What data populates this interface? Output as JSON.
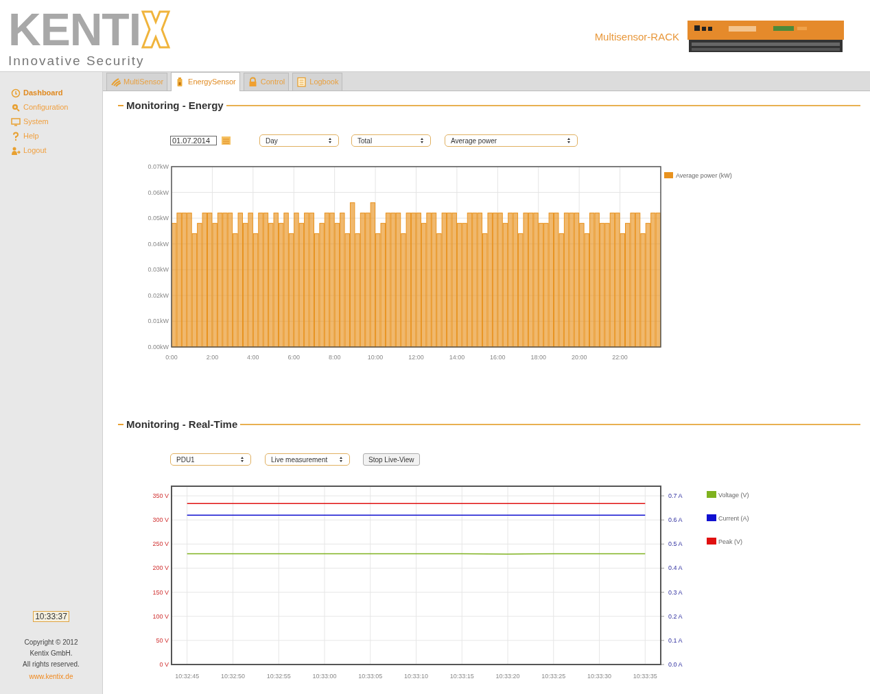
{
  "header": {
    "logo_text": "KENTI",
    "tagline": "Innovative Security",
    "device_name": "Multisensor-RACK"
  },
  "sidebar": {
    "items": [
      {
        "label": "Dashboard",
        "selected": true
      },
      {
        "label": "Configuration",
        "selected": false
      },
      {
        "label": "System",
        "selected": false
      },
      {
        "label": "Help",
        "selected": false
      },
      {
        "label": "Logout",
        "selected": false
      }
    ],
    "clock": "10:33:37",
    "copyright": [
      "Copyright © 2012",
      "Kentix GmbH.",
      "All rights reserved."
    ],
    "link": "www.kentix.de"
  },
  "tabs": [
    {
      "label": "MultiSensor",
      "selected": false
    },
    {
      "label": "EnergySensor",
      "selected": true
    },
    {
      "label": "Control",
      "selected": false
    },
    {
      "label": "Logbook",
      "selected": false
    }
  ],
  "energy": {
    "title": "Monitoring - Energy",
    "date": "01.07.2014",
    "selects": [
      "Day",
      "Total",
      "Average power"
    ],
    "chart_data": {
      "type": "bar",
      "x": [
        0,
        0.25,
        0.5,
        0.75,
        1,
        1.25,
        1.5,
        1.75,
        2,
        2.25,
        2.5,
        2.75,
        3,
        3.25,
        3.5,
        3.75,
        4,
        4.25,
        4.5,
        4.75,
        5,
        5.25,
        5.5,
        5.75,
        6,
        6.25,
        6.5,
        6.75,
        7,
        7.25,
        7.5,
        7.75,
        8,
        8.25,
        8.5,
        8.75,
        9,
        9.25,
        9.5,
        9.75,
        10,
        10.25,
        10.5,
        10.75,
        11,
        11.25,
        11.5,
        11.75,
        12,
        12.25,
        12.5,
        12.75,
        13,
        13.25,
        13.5,
        13.75,
        14,
        14.25,
        14.5,
        14.75,
        15,
        15.25,
        15.5,
        15.75,
        16,
        16.25,
        16.5,
        16.75,
        17,
        17.25,
        17.5,
        17.75,
        18,
        18.25,
        18.5,
        18.75,
        19,
        19.25,
        19.5,
        19.75,
        20,
        20.25,
        20.5,
        20.75,
        21,
        21.25,
        21.5,
        21.75,
        22,
        22.25,
        22.5,
        22.75,
        23,
        23.25,
        23.5,
        23.75
      ],
      "series": [
        {
          "name": "Average power (kW)",
          "color": "#e8921e",
          "values": [
            0.048,
            0.052,
            0.052,
            0.052,
            0.044,
            0.048,
            0.052,
            0.052,
            0.048,
            0.052,
            0.052,
            0.052,
            0.044,
            0.052,
            0.048,
            0.052,
            0.044,
            0.052,
            0.052,
            0.048,
            0.052,
            0.048,
            0.052,
            0.044,
            0.052,
            0.048,
            0.052,
            0.052,
            0.044,
            0.048,
            0.052,
            0.052,
            0.048,
            0.052,
            0.044,
            0.056,
            0.044,
            0.052,
            0.052,
            0.056,
            0.044,
            0.048,
            0.052,
            0.052,
            0.052,
            0.044,
            0.052,
            0.052,
            0.052,
            0.048,
            0.052,
            0.052,
            0.044,
            0.052,
            0.052,
            0.052,
            0.048,
            0.048,
            0.052,
            0.052,
            0.052,
            0.044,
            0.052,
            0.052,
            0.052,
            0.048,
            0.052,
            0.052,
            0.044,
            0.052,
            0.052,
            0.052,
            0.048,
            0.048,
            0.052,
            0.052,
            0.044,
            0.052,
            0.052,
            0.052,
            0.048,
            0.044,
            0.052,
            0.052,
            0.048,
            0.048,
            0.052,
            0.052,
            0.044,
            0.048,
            0.052,
            0.052,
            0.044,
            0.048,
            0.052,
            0.052
          ]
        }
      ],
      "xlim": [
        0,
        24
      ],
      "ylim": [
        0,
        0.07
      ],
      "grid": true,
      "legend": true,
      "xticks": [
        {
          "value": 0,
          "label": "0:00"
        },
        {
          "value": 2,
          "label": "2:00"
        },
        {
          "value": 4,
          "label": "4:00"
        },
        {
          "value": 6,
          "label": "6:00"
        },
        {
          "value": 8,
          "label": "8:00"
        },
        {
          "value": 10,
          "label": "10:00"
        },
        {
          "value": 12,
          "label": "12:00"
        },
        {
          "value": 14,
          "label": "14:00"
        },
        {
          "value": 16,
          "label": "16:00"
        },
        {
          "value": 18,
          "label": "18:00"
        },
        {
          "value": 20,
          "label": "20:00"
        },
        {
          "value": 22,
          "label": "22:00"
        }
      ],
      "yticks": [
        {
          "value": 0,
          "label": "0.00kW"
        },
        {
          "value": 0.01,
          "label": "0.01kW"
        },
        {
          "value": 0.02,
          "label": "0.02kW"
        },
        {
          "value": 0.03,
          "label": "0.03kW"
        },
        {
          "value": 0.04,
          "label": "0.04kW"
        },
        {
          "value": 0.05,
          "label": "0.05kW"
        },
        {
          "value": 0.06,
          "label": "0.06kW"
        },
        {
          "value": 0.07,
          "label": "0.07kW"
        }
      ]
    }
  },
  "realtime": {
    "title": "Monitoring - Real-Time",
    "selects": [
      "PDU1",
      "Live measurement"
    ],
    "button": "Stop Live-View",
    "chart_data": {
      "type": "line",
      "categories": [
        "10:32:45",
        "10:32:50",
        "10:32:55",
        "10:33:00",
        "10:33:05",
        "10:33:10",
        "10:33:15",
        "10:33:20",
        "10:33:25",
        "10:33:30",
        "10:33:35"
      ],
      "series": [
        {
          "name": "Voltage (V)",
          "color": "#7fb21f",
          "values": [
            230,
            230,
            230,
            230,
            230,
            230,
            230,
            229,
            230,
            230,
            230
          ]
        },
        {
          "name": "Current (A)",
          "color": "#1010d0",
          "axis": "y2",
          "values": [
            0.62,
            0.62,
            0.62,
            0.62,
            0.62,
            0.62,
            0.62,
            0.62,
            0.62,
            0.62,
            0.62
          ]
        },
        {
          "name": "Peak (V)",
          "color": "#e01010",
          "values": [
            334,
            334,
            334,
            334,
            334,
            334,
            334,
            334,
            334,
            334,
            334
          ]
        }
      ],
      "ylim": [
        0,
        370
      ],
      "y2lim": [
        0,
        0.74
      ],
      "grid": true,
      "legend": true,
      "yticks": [
        {
          "value": 0,
          "label": "0 V"
        },
        {
          "value": 50,
          "label": "50 V"
        },
        {
          "value": 100,
          "label": "100 V"
        },
        {
          "value": 150,
          "label": "150 V"
        },
        {
          "value": 200,
          "label": "200 V"
        },
        {
          "value": 250,
          "label": "250 V"
        },
        {
          "value": 300,
          "label": "300 V"
        },
        {
          "value": 350,
          "label": "350 V"
        }
      ],
      "y2ticks": [
        {
          "value": 0,
          "label": "0.0 A"
        },
        {
          "value": 0.1,
          "label": "0.1 A"
        },
        {
          "value": 0.2,
          "label": "0.2 A"
        },
        {
          "value": 0.3,
          "label": "0.3 A"
        },
        {
          "value": 0.4,
          "label": "0.4 A"
        },
        {
          "value": 0.5,
          "label": "0.5 A"
        },
        {
          "value": 0.6,
          "label": "0.6 A"
        },
        {
          "value": 0.7,
          "label": "0.7 A"
        }
      ]
    }
  }
}
